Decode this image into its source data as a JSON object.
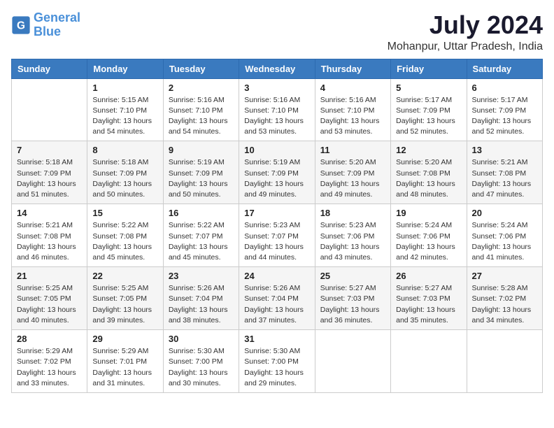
{
  "header": {
    "logo_line1": "General",
    "logo_line2": "Blue",
    "month_year": "July 2024",
    "location": "Mohanpur, Uttar Pradesh, India"
  },
  "weekdays": [
    "Sunday",
    "Monday",
    "Tuesday",
    "Wednesday",
    "Thursday",
    "Friday",
    "Saturday"
  ],
  "weeks": [
    [
      {
        "day": "",
        "info": ""
      },
      {
        "day": "1",
        "info": "Sunrise: 5:15 AM\nSunset: 7:10 PM\nDaylight: 13 hours\nand 54 minutes."
      },
      {
        "day": "2",
        "info": "Sunrise: 5:16 AM\nSunset: 7:10 PM\nDaylight: 13 hours\nand 54 minutes."
      },
      {
        "day": "3",
        "info": "Sunrise: 5:16 AM\nSunset: 7:10 PM\nDaylight: 13 hours\nand 53 minutes."
      },
      {
        "day": "4",
        "info": "Sunrise: 5:16 AM\nSunset: 7:10 PM\nDaylight: 13 hours\nand 53 minutes."
      },
      {
        "day": "5",
        "info": "Sunrise: 5:17 AM\nSunset: 7:09 PM\nDaylight: 13 hours\nand 52 minutes."
      },
      {
        "day": "6",
        "info": "Sunrise: 5:17 AM\nSunset: 7:09 PM\nDaylight: 13 hours\nand 52 minutes."
      }
    ],
    [
      {
        "day": "7",
        "info": "Sunrise: 5:18 AM\nSunset: 7:09 PM\nDaylight: 13 hours\nand 51 minutes."
      },
      {
        "day": "8",
        "info": "Sunrise: 5:18 AM\nSunset: 7:09 PM\nDaylight: 13 hours\nand 50 minutes."
      },
      {
        "day": "9",
        "info": "Sunrise: 5:19 AM\nSunset: 7:09 PM\nDaylight: 13 hours\nand 50 minutes."
      },
      {
        "day": "10",
        "info": "Sunrise: 5:19 AM\nSunset: 7:09 PM\nDaylight: 13 hours\nand 49 minutes."
      },
      {
        "day": "11",
        "info": "Sunrise: 5:20 AM\nSunset: 7:09 PM\nDaylight: 13 hours\nand 49 minutes."
      },
      {
        "day": "12",
        "info": "Sunrise: 5:20 AM\nSunset: 7:08 PM\nDaylight: 13 hours\nand 48 minutes."
      },
      {
        "day": "13",
        "info": "Sunrise: 5:21 AM\nSunset: 7:08 PM\nDaylight: 13 hours\nand 47 minutes."
      }
    ],
    [
      {
        "day": "14",
        "info": "Sunrise: 5:21 AM\nSunset: 7:08 PM\nDaylight: 13 hours\nand 46 minutes."
      },
      {
        "day": "15",
        "info": "Sunrise: 5:22 AM\nSunset: 7:08 PM\nDaylight: 13 hours\nand 45 minutes."
      },
      {
        "day": "16",
        "info": "Sunrise: 5:22 AM\nSunset: 7:07 PM\nDaylight: 13 hours\nand 45 minutes."
      },
      {
        "day": "17",
        "info": "Sunrise: 5:23 AM\nSunset: 7:07 PM\nDaylight: 13 hours\nand 44 minutes."
      },
      {
        "day": "18",
        "info": "Sunrise: 5:23 AM\nSunset: 7:06 PM\nDaylight: 13 hours\nand 43 minutes."
      },
      {
        "day": "19",
        "info": "Sunrise: 5:24 AM\nSunset: 7:06 PM\nDaylight: 13 hours\nand 42 minutes."
      },
      {
        "day": "20",
        "info": "Sunrise: 5:24 AM\nSunset: 7:06 PM\nDaylight: 13 hours\nand 41 minutes."
      }
    ],
    [
      {
        "day": "21",
        "info": "Sunrise: 5:25 AM\nSunset: 7:05 PM\nDaylight: 13 hours\nand 40 minutes."
      },
      {
        "day": "22",
        "info": "Sunrise: 5:25 AM\nSunset: 7:05 PM\nDaylight: 13 hours\nand 39 minutes."
      },
      {
        "day": "23",
        "info": "Sunrise: 5:26 AM\nSunset: 7:04 PM\nDaylight: 13 hours\nand 38 minutes."
      },
      {
        "day": "24",
        "info": "Sunrise: 5:26 AM\nSunset: 7:04 PM\nDaylight: 13 hours\nand 37 minutes."
      },
      {
        "day": "25",
        "info": "Sunrise: 5:27 AM\nSunset: 7:03 PM\nDaylight: 13 hours\nand 36 minutes."
      },
      {
        "day": "26",
        "info": "Sunrise: 5:27 AM\nSunset: 7:03 PM\nDaylight: 13 hours\nand 35 minutes."
      },
      {
        "day": "27",
        "info": "Sunrise: 5:28 AM\nSunset: 7:02 PM\nDaylight: 13 hours\nand 34 minutes."
      }
    ],
    [
      {
        "day": "28",
        "info": "Sunrise: 5:29 AM\nSunset: 7:02 PM\nDaylight: 13 hours\nand 33 minutes."
      },
      {
        "day": "29",
        "info": "Sunrise: 5:29 AM\nSunset: 7:01 PM\nDaylight: 13 hours\nand 31 minutes."
      },
      {
        "day": "30",
        "info": "Sunrise: 5:30 AM\nSunset: 7:00 PM\nDaylight: 13 hours\nand 30 minutes."
      },
      {
        "day": "31",
        "info": "Sunrise: 5:30 AM\nSunset: 7:00 PM\nDaylight: 13 hours\nand 29 minutes."
      },
      {
        "day": "",
        "info": ""
      },
      {
        "day": "",
        "info": ""
      },
      {
        "day": "",
        "info": ""
      }
    ]
  ]
}
